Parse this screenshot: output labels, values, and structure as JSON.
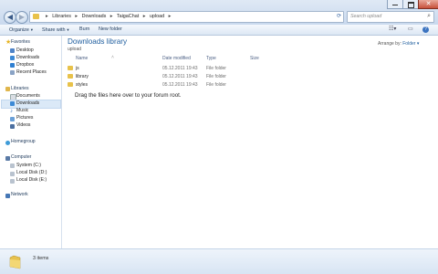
{
  "address": {
    "crumbs": [
      "Libraries",
      "Downloads",
      "TaigaChat",
      "upload"
    ]
  },
  "search": {
    "placeholder": "Search upload"
  },
  "toolbar": {
    "organize": "Organize",
    "share_with": "Share with",
    "burn": "Burn",
    "new_folder": "New folder"
  },
  "nav": {
    "favorites": "Favorites",
    "desktop": "Desktop",
    "downloads_fav": "Downloads",
    "dropbox": "Dropbox",
    "recent": "Recent Places",
    "libraries": "Libraries",
    "documents": "Documents",
    "downloads_lib": "Downloads",
    "music": "Music",
    "pictures": "Pictures",
    "videos": "Videos",
    "homegroup": "Homegroup",
    "computer": "Computer",
    "system": "System (C:)",
    "local_d": "Local Disk (D:)",
    "local_e": "Local Disk (E:)",
    "network": "Network"
  },
  "content": {
    "title": "Downloads library",
    "subtitle": "upload",
    "arrange_label": "Arrange by:",
    "arrange_value": "Folder",
    "columns": {
      "name": "Name",
      "date": "Date modified",
      "type": "Type",
      "size": "Size"
    },
    "rows": [
      {
        "name": "js",
        "date": "05.12.2011 19:43",
        "type": "File folder"
      },
      {
        "name": "library",
        "date": "05.12.2011 19:43",
        "type": "File folder"
      },
      {
        "name": "styles",
        "date": "05.12.2011 19:43",
        "type": "File folder"
      }
    ],
    "drop_hint": "Drag the files here over to your forum root."
  },
  "status": {
    "count": "3 items"
  }
}
